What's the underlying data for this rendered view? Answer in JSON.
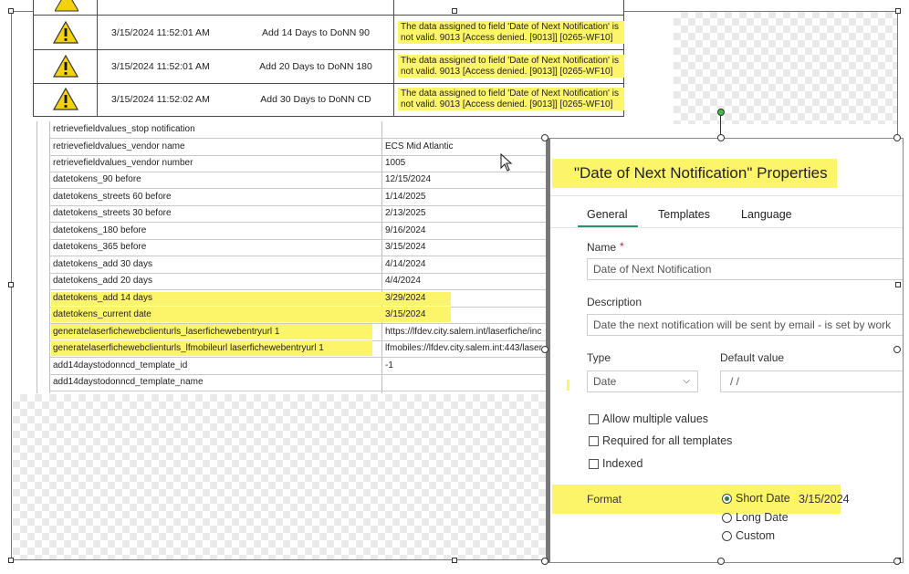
{
  "warnings": [
    {
      "timestamp": "3/15/2024 11:52:01 AM",
      "action": "Add 14 Days to DoNN 90",
      "message": "The data assigned to field 'Date of Next Notification' is not valid. 9013 [Access denied. [9013]] [0265-WF10]"
    },
    {
      "timestamp": "3/15/2024 11:52:01 AM",
      "action": "Add 20 Days to DoNN 180",
      "message": "The data assigned to field 'Date of Next Notification' is not valid. 9013 [Access denied. [9013]] [0265-WF10]"
    },
    {
      "timestamp": "3/15/2024 11:52:02 AM",
      "action": "Add 30 Days to DoNN CD",
      "message": "The data assigned to field 'Date of Next Notification' is not valid. 9013 [Access denied. [9013]] [0265-WF10]"
    }
  ],
  "fields": [
    {
      "name": "retrievefieldvalues_stop notification",
      "value": ""
    },
    {
      "name": "retrievefieldvalues_vendor name",
      "value": "ECS Mid Atlantic"
    },
    {
      "name": "retrievefieldvalues_vendor number",
      "value": "1005"
    },
    {
      "name": "datetokens_90 before",
      "value": "12/15/2024"
    },
    {
      "name": "datetokens_streets 60 before",
      "value": "1/14/2025"
    },
    {
      "name": "datetokens_streets 30 before",
      "value": "2/13/2025"
    },
    {
      "name": "datetokens_180 before",
      "value": "9/16/2024"
    },
    {
      "name": "datetokens_365 before",
      "value": "3/15/2024"
    },
    {
      "name": "datetokens_add 30 days",
      "value": "4/14/2024"
    },
    {
      "name": "datetokens_add 20 days",
      "value": "4/4/2024"
    },
    {
      "name": "datetokens_add 14 days",
      "value": "3/29/2024"
    },
    {
      "name": "datetokens_current date",
      "value": "3/15/2024"
    },
    {
      "name": "generatelaserfichewebclienturls_laserfichewebentryurl 1",
      "value": "https://lfdev.city.salem.int/laserfiche/inc"
    },
    {
      "name": "generatelaserfichewebclienturls_lfmobileurl laserfichewebentryurl 1",
      "value": "lfmobiles://lfdev.city.salem.int:443/laser"
    },
    {
      "name": "add14daystodonncd_template_id",
      "value": "-1"
    },
    {
      "name": "add14daystodonncd_template_name",
      "value": ""
    }
  ],
  "dialog": {
    "title": "\"Date of Next Notification\" Properties",
    "tabs": [
      "General",
      "Templates",
      "Language"
    ],
    "name_label": "Name",
    "required_mark": "*",
    "name_value": "Date of Next Notification",
    "description_label": "Description",
    "description_value": "Date the next notification will be sent by email - is set by work",
    "type_label": "Type",
    "type_value": "Date",
    "default_label": "Default value",
    "default_value": "/ /",
    "checkboxes": [
      "Allow multiple values",
      "Required for all templates",
      "Indexed"
    ],
    "format_label": "Format",
    "format_options": [
      "Short Date",
      "Long Date",
      "Custom"
    ],
    "format_sample": "3/15/2024"
  },
  "colors": {
    "highlight": "#fdf569",
    "tab_accent": "#2a8f6a",
    "warning": "#f3d10c",
    "handle_green": "#3fbf3f"
  }
}
